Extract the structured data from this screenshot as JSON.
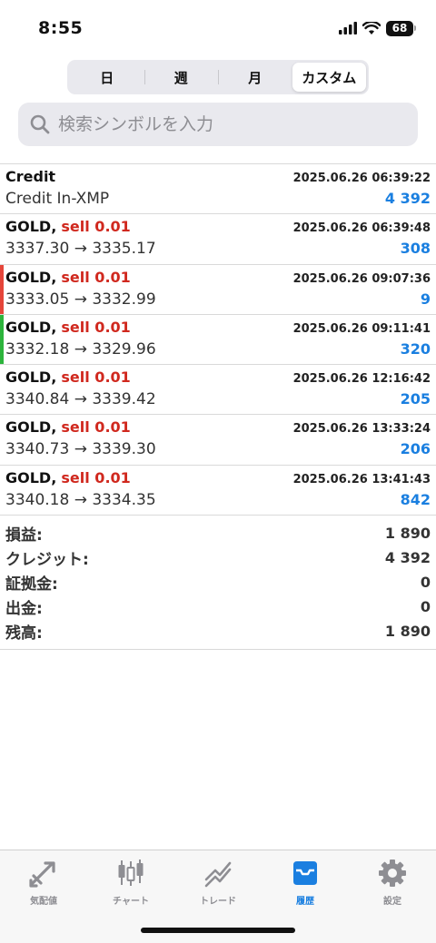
{
  "status": {
    "time": "8:55",
    "battery": "68"
  },
  "segments": [
    {
      "label": "日",
      "active": false
    },
    {
      "label": "週",
      "active": false
    },
    {
      "label": "月",
      "active": false
    },
    {
      "label": "カスタム",
      "active": true
    }
  ],
  "search": {
    "placeholder": "検索シンボルを入力"
  },
  "rows": [
    {
      "symbol": "Credit",
      "action": "",
      "time": "2025.06.26 06:39:22",
      "desc": "Credit In-XMP",
      "profit": "4 392",
      "marker": ""
    },
    {
      "symbol": "GOLD,",
      "action": "sell 0.01",
      "time": "2025.06.26 06:39:48",
      "desc": "3337.30 → 3335.17",
      "profit": "308",
      "marker": ""
    },
    {
      "symbol": "GOLD,",
      "action": "sell 0.01",
      "time": "2025.06.26 09:07:36",
      "desc": "3333.05 → 3332.99",
      "profit": "9",
      "marker": "#e5453a"
    },
    {
      "symbol": "GOLD,",
      "action": "sell 0.01",
      "time": "2025.06.26 09:11:41",
      "desc": "3332.18 → 3329.96",
      "profit": "320",
      "marker": "#2db43c"
    },
    {
      "symbol": "GOLD,",
      "action": "sell 0.01",
      "time": "2025.06.26 12:16:42",
      "desc": "3340.84 → 3339.42",
      "profit": "205",
      "marker": ""
    },
    {
      "symbol": "GOLD,",
      "action": "sell 0.01",
      "time": "2025.06.26 13:33:24",
      "desc": "3340.73 → 3339.30",
      "profit": "206",
      "marker": ""
    },
    {
      "symbol": "GOLD,",
      "action": "sell 0.01",
      "time": "2025.06.26 13:41:43",
      "desc": "3340.18 → 3334.35",
      "profit": "842",
      "marker": ""
    }
  ],
  "summary": [
    {
      "label": "損益:",
      "value": "1 890"
    },
    {
      "label": "クレジット:",
      "value": "4 392"
    },
    {
      "label": "証拠金:",
      "value": "0"
    },
    {
      "label": "出金:",
      "value": "0"
    },
    {
      "label": "残高:",
      "value": "1 890"
    }
  ],
  "tabs": [
    {
      "label": "気配値",
      "icon": "quotes-icon",
      "active": false
    },
    {
      "label": "チャート",
      "icon": "chart-icon",
      "active": false
    },
    {
      "label": "トレード",
      "icon": "trade-icon",
      "active": false
    },
    {
      "label": "履歴",
      "icon": "history-icon",
      "active": true
    },
    {
      "label": "設定",
      "icon": "settings-icon",
      "active": false
    }
  ],
  "colors": {
    "accent": "#1a7fe0",
    "sell": "#d0281e",
    "tab_inactive": "#8e8e93"
  }
}
